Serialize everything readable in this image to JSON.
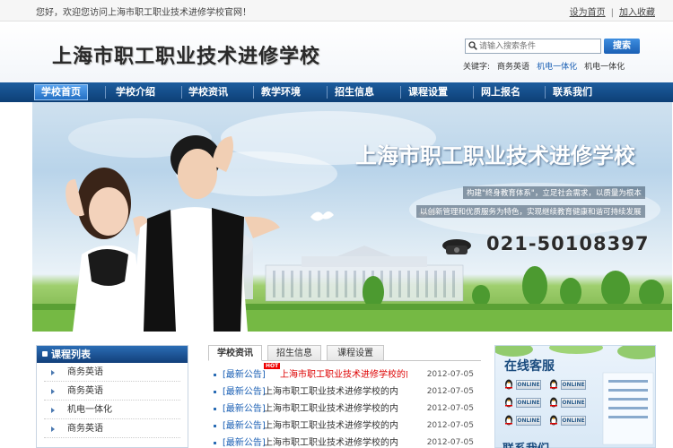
{
  "topbar": {
    "welcome": "您好，欢迎您访问上海市职工职业技术进修学校官网！",
    "set_home": "设为首页",
    "separator": "|",
    "add_favorite": "加入收藏"
  },
  "header": {
    "school_name": "上海市职工职业技术进修学校",
    "search_placeholder": "请输入搜索条件",
    "search_button": "搜索",
    "keywords_label": "关键字:",
    "keywords": [
      "商务英语",
      "机电一体化",
      "机电一体化"
    ]
  },
  "nav": {
    "items": [
      "学校首页",
      "学校介绍",
      "学校资讯",
      "教学环境",
      "招生信息",
      "课程设置",
      "网上报名",
      "联系我们"
    ]
  },
  "banner": {
    "title": "上海市职工职业技术进修学校",
    "slogan1": "构建\"终身教育体系\"，立足社会需求，以质量为根本",
    "slogan2": "以创新管理和优质服务为特色，实现继续教育健康和谐可持续发展",
    "phone": "021-50108397"
  },
  "courses": {
    "title": "课程列表",
    "items": [
      "商务英语",
      "商务英语",
      "机电一体化",
      "商务英语"
    ]
  },
  "news": {
    "tabs": [
      "学校资讯",
      "招生信息",
      "课程设置"
    ],
    "hot_label": "HOT",
    "rows": [
      {
        "tag": "[最新公告]",
        "text": "上海市职工职业技术进修学校的内训课",
        "date": "2012-07-05"
      },
      {
        "tag": "[最新公告]",
        "text": "上海市职工职业技术进修学校的内训课",
        "date": "2012-07-05"
      },
      {
        "tag": "[最新公告]",
        "text": "上海市职工职业技术进修学校的内训课",
        "date": "2012-07-05"
      },
      {
        "tag": "[最新公告]",
        "text": "上海市职工职业技术进修学校的内训课",
        "date": "2012-07-05"
      },
      {
        "tag": "[最新公告]",
        "text": "上海市职工职业技术进修学校的内训课",
        "date": "2012-07-05"
      }
    ]
  },
  "service": {
    "title": "在线客服",
    "badge": "ONLINE"
  },
  "contact": {
    "title": "联系我们"
  },
  "colors": {
    "nav": "#0d3f76",
    "accent": "#1a5fb4",
    "hot_red": "#dd0000"
  }
}
